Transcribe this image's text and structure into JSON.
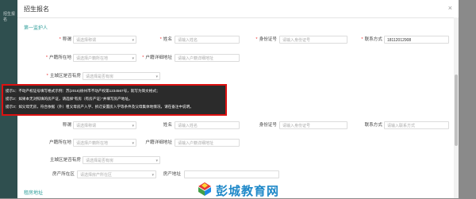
{
  "background": {
    "tab_label": "招生报名"
  },
  "modal": {
    "title": "招生报名",
    "close": "×"
  },
  "sections": {
    "guardian1": "第一监护人",
    "rent_address": "租房地址"
  },
  "labels": {
    "title": "称谓",
    "name": "姓名",
    "id_number": "身份证号",
    "phone": "联系方式",
    "hukou_location": "户籍所在地",
    "hukou_address": "户籍详细地址",
    "main_district_house": "主城区是否有房",
    "house_district": "房产所在区",
    "house_address": "房产地址"
  },
  "placeholders": {
    "select_title": "请选择称谓",
    "input_name": "请输入姓名",
    "input_id": "请输入身份证号",
    "input_phone": "请输入联系方式",
    "select_hukou": "请选择户籍所在地",
    "input_hukou_address": "请输入户籍详细地址",
    "select_main_house": "请选择是否有房",
    "select_house_district": "请选择房产所在区"
  },
  "values": {
    "phone1": "18112012908"
  },
  "tooltip": {
    "line1": "提示1：不动产权证号填写格式示例：苏(2016)徐州市不动产权第1234567号，就写为简文格式；",
    "line2": "提示2：如果本无对照填的房产证，请选择“有房（有房产证）”并填写房产地址。",
    "line3": "提示3：如父母无房，符合依据（外）租父母房产入学、拆迁安置房入学等条件及父母集体地情况，请在备注中说明。"
  },
  "watermark": {
    "text": "彭城教育网"
  },
  "colors": {
    "accent": "#2e9e9a",
    "required": "#ee3333",
    "tooltip_border": "#dd1111",
    "watermark": "#1e88c8"
  }
}
